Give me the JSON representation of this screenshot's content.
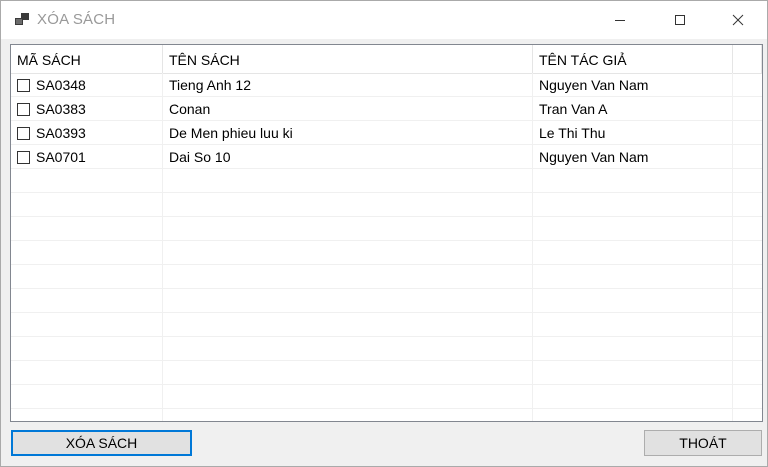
{
  "window": {
    "title": "XÓA SÁCH"
  },
  "table": {
    "columns": [
      "MÃ SÁCH",
      "TÊN SÁCH",
      "TÊN TÁC GIẢ"
    ],
    "rows": [
      {
        "id": "SA0348",
        "title": "Tieng Anh 12",
        "author": "Nguyen Van Nam",
        "checked": false
      },
      {
        "id": "SA0383",
        "title": "Conan",
        "author": "Tran Van A",
        "checked": false
      },
      {
        "id": "SA0393",
        "title": "De Men phieu luu ki",
        "author": "Le Thi Thu",
        "checked": false
      },
      {
        "id": "SA0701",
        "title": "Dai So 10",
        "author": "Nguyen Van Nam",
        "checked": false
      }
    ]
  },
  "buttons": {
    "delete_label": "XÓA SÁCH",
    "exit_label": "THOÁT"
  },
  "colors": {
    "focus_border": "#0078d7",
    "button_face": "#e1e1e1",
    "window_bg": "#f0f0f0"
  }
}
